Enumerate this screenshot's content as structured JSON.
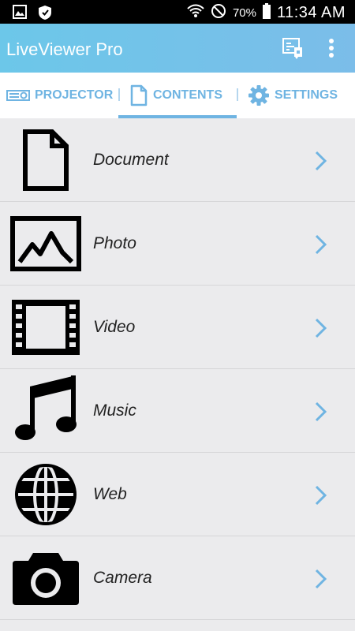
{
  "status_bar": {
    "battery": "70%",
    "time": "11:34 AM"
  },
  "app_bar": {
    "title": "LiveViewer Pro"
  },
  "tabs": [
    {
      "label": "PROJECTOR"
    },
    {
      "label": "CONTENTS",
      "selected": true
    },
    {
      "label": "SETTINGS"
    }
  ],
  "list": [
    {
      "label": "Document",
      "icon": "document-icon"
    },
    {
      "label": "Photo",
      "icon": "photo-icon"
    },
    {
      "label": "Video",
      "icon": "film-icon"
    },
    {
      "label": "Music",
      "icon": "music-note-icon"
    },
    {
      "label": "Web",
      "icon": "globe-icon"
    },
    {
      "label": "Camera",
      "icon": "camera-icon"
    }
  ],
  "colors": {
    "accent": "#6fb4e2",
    "app_bar_start": "#6cc7e9",
    "app_bar_end": "#7bbde9",
    "list_bg": "#ebebed"
  }
}
